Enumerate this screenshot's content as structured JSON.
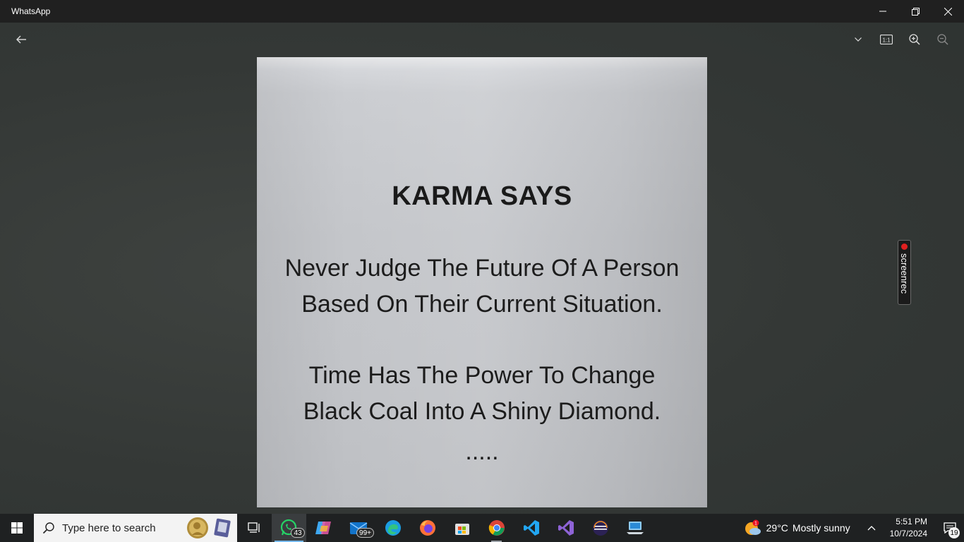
{
  "window": {
    "title": "WhatsApp",
    "minimize_icon": "minimize-icon",
    "restore_icon": "restore-icon",
    "close_icon": "close-icon"
  },
  "viewer": {
    "back_icon": "arrow-left-icon",
    "tools": [
      "chevron-down-icon",
      "actual-size-icon",
      "zoom-in-icon",
      "zoom-out-icon"
    ],
    "actual_size_label": "1:1"
  },
  "photo": {
    "title": "KARMA SAYS",
    "lines": [
      "Never Judge The Future Of A Person",
      "Based On Their Current Situation.",
      "Time Has The Power To Change",
      "Black Coal Into A Shiny Diamond.",
      "....."
    ]
  },
  "overlay": {
    "screenrec_label": "screenrec"
  },
  "taskbar": {
    "search_placeholder": "Type here to search",
    "apps": [
      {
        "name": "task-view",
        "icon": "task-view-icon"
      },
      {
        "name": "whatsapp",
        "icon": "whatsapp-icon",
        "badge": "43",
        "active": true
      },
      {
        "name": "copilot",
        "icon": "copilot-icon"
      },
      {
        "name": "mail",
        "icon": "mail-icon",
        "badge": "99+"
      },
      {
        "name": "edge",
        "icon": "edge-icon"
      },
      {
        "name": "firefox",
        "icon": "firefox-icon"
      },
      {
        "name": "store",
        "icon": "store-icon"
      },
      {
        "name": "chrome",
        "icon": "chrome-icon",
        "running": true
      },
      {
        "name": "vscode",
        "icon": "vscode-icon"
      },
      {
        "name": "visual-studio",
        "icon": "visual-studio-icon"
      },
      {
        "name": "eclipse",
        "icon": "eclipse-icon"
      },
      {
        "name": "laptop-app",
        "icon": "laptop-icon"
      }
    ],
    "weather": {
      "temp": "29°C",
      "desc": "Mostly sunny",
      "alert": "1"
    },
    "clock": {
      "time": "5:51 PM",
      "date": "10/7/2024"
    },
    "notifications": "19"
  },
  "colors": {
    "accent": "#76b9ed",
    "titlebar": "#202020",
    "taskbar": "#1f2122"
  }
}
